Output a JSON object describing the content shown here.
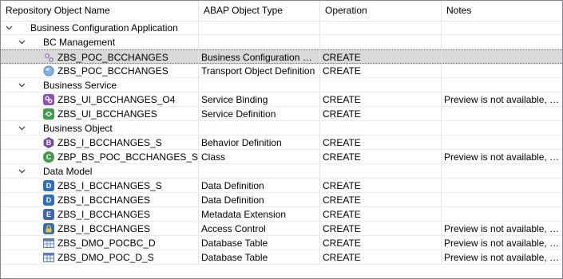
{
  "headers": {
    "name": "Repository Object Name",
    "type": "ABAP Object Type",
    "operation": "Operation",
    "notes": "Notes"
  },
  "tree": {
    "root": "Business Configuration Application",
    "bc_management": "BC Management",
    "business_service": "Business Service",
    "business_object": "Business Object",
    "data_model": "Data Model"
  },
  "rows": [
    {
      "name": "ZBS_POC_BCCHANGES",
      "type": "Business Configuration Maintenance Object",
      "operation": "CREATE",
      "notes": "",
      "icon": "business-configuration-icon"
    },
    {
      "name": "ZBS_POC_BCCHANGES",
      "type": "Transport Object Definition",
      "operation": "CREATE",
      "notes": "",
      "icon": "transport-object-icon"
    },
    {
      "name": "ZBS_UI_BCCHANGES_O4",
      "type": "Service Binding",
      "operation": "CREATE",
      "notes": "Preview is not available, h...",
      "icon": "service-binding-icon"
    },
    {
      "name": "ZBS_UI_BCCHANGES",
      "type": "Service Definition",
      "operation": "CREATE",
      "notes": "",
      "icon": "service-definition-icon"
    },
    {
      "name": "ZBS_I_BCCHANGES_S",
      "type": "Behavior Definition",
      "operation": "CREATE",
      "notes": "",
      "icon": "behavior-definition-icon"
    },
    {
      "name": "ZBP_BS_POC_BCCHANGES_S",
      "type": "Class",
      "operation": "CREATE",
      "notes": "Preview is not available, h...",
      "icon": "class-icon"
    },
    {
      "name": "ZBS_I_BCCHANGES_S",
      "type": "Data Definition",
      "operation": "CREATE",
      "notes": "",
      "icon": "data-definition-icon"
    },
    {
      "name": "ZBS_I_BCCHANGES",
      "type": "Data Definition",
      "operation": "CREATE",
      "notes": "",
      "icon": "data-definition-icon"
    },
    {
      "name": "ZBS_I_BCCHANGES",
      "type": "Metadata Extension",
      "operation": "CREATE",
      "notes": "",
      "icon": "metadata-extension-icon"
    },
    {
      "name": "ZBS_I_BCCHANGES",
      "type": "Access Control",
      "operation": "CREATE",
      "notes": "Preview is not available, h...",
      "icon": "access-control-icon"
    },
    {
      "name": "ZBS_DMO_POCBC_D",
      "type": "Database Table",
      "operation": "CREATE",
      "notes": "Preview is not available, h...",
      "icon": "database-table-icon"
    },
    {
      "name": "ZBS_DMO_POC_D_S",
      "type": "Database Table",
      "operation": "CREATE",
      "notes": "Preview is not available, h...",
      "icon": "database-table-icon"
    }
  ],
  "glyphs": {
    "behavior": "B",
    "class": "C",
    "data_definition": "D",
    "metadata": "E"
  }
}
